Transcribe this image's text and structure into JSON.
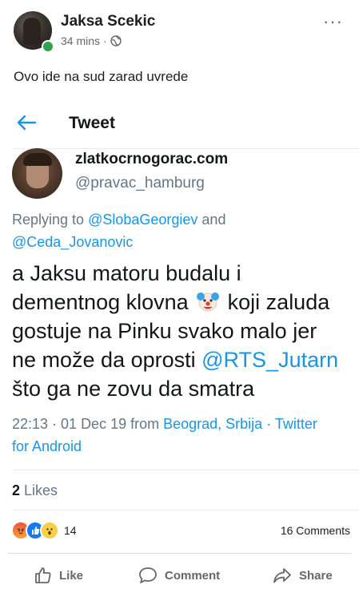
{
  "post": {
    "author": "Jaksa Scekic",
    "time": "34 mins",
    "meta_separator": "·",
    "more_label": "···",
    "text": "Ovo ide na sud zarad uvrede"
  },
  "tweet": {
    "nav_title": "Tweet",
    "display_name": "zlatkocrnogorac.com",
    "handle": "@pravac_hamburg",
    "replying_prefix": "Replying to ",
    "reply_user1": "@SlobaGeorgiev",
    "reply_and": " and",
    "reply_user2": "@Ceda_Jovanovic",
    "body_line1": "a Jaksu matoru budalu i",
    "body_line2_a": "dementnog klovna ",
    "body_line2_b": " koji zaluda",
    "body_line3": "gostuje na Pinku svako malo jer",
    "body_line4_a": "ne može da oprosti ",
    "body_line4_mention": "@RTS_Jutarn",
    "body_line5": "što ga ne zovu da smatra",
    "timestamp": "22:13 · 01 Dec 19 from ",
    "location": "Beograd, Srbija",
    "sep": " · ",
    "source_a": "Twitter",
    "source_b": "for Android",
    "likes_count": "2",
    "likes_label": " Likes"
  },
  "engagement": {
    "reaction_count": "14",
    "comments": "16 Comments",
    "reaction_icons": [
      "angry-reaction",
      "like-reaction",
      "wow-reaction"
    ]
  },
  "actions": {
    "like": "Like",
    "comment": "Comment",
    "share": "Share"
  },
  "colors": {
    "twitter_blue": "#1b95e0",
    "fb_online": "#31a24c",
    "fb_blue": "#1877f2"
  }
}
